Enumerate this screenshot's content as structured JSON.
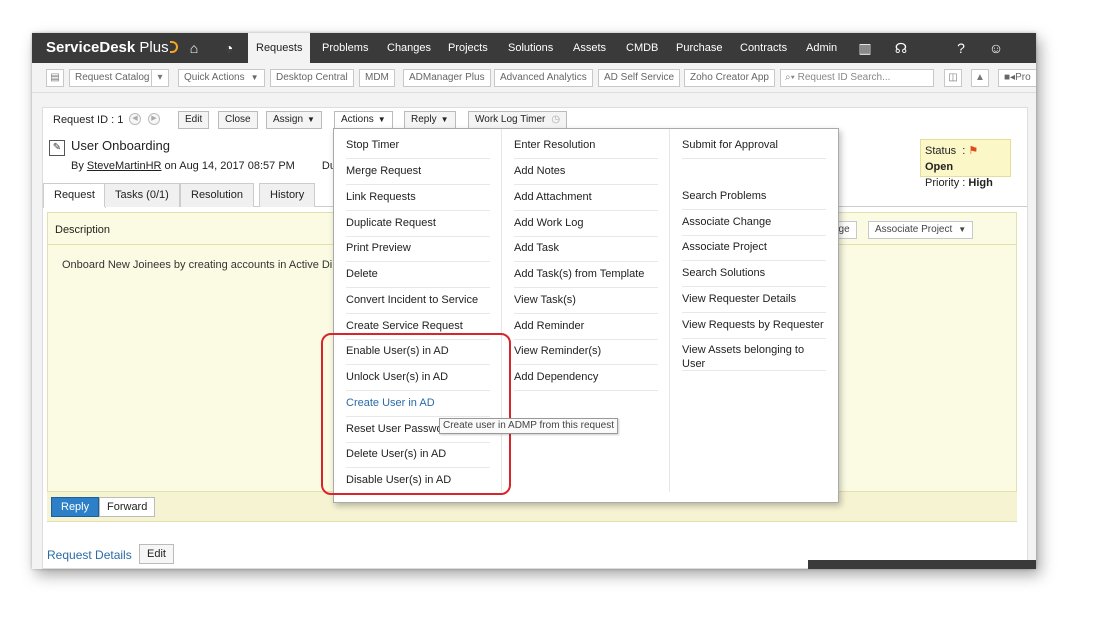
{
  "nav": {
    "brand_main": "ServiceDesk",
    "brand_plus": "Plus",
    "tabs": [
      "Requests",
      "Problems",
      "Changes",
      "Projects",
      "Solutions",
      "Assets",
      "CMDB",
      "Purchase",
      "Contracts",
      "Admin"
    ]
  },
  "subbar": {
    "buttons": [
      "Request Catalog",
      "Quick Actions",
      "Desktop Central",
      "MDM",
      "ADManager Plus",
      "Advanced Analytics",
      "AD Self Service",
      "Zoho Creator App"
    ],
    "search_placeholder": "Request ID Search...",
    "overflow": "Pro"
  },
  "request": {
    "id_label": "Request ID : 1",
    "buttons": {
      "edit": "Edit",
      "close": "Close",
      "assign": "Assign",
      "actions": "Actions",
      "reply": "Reply",
      "worklog": "Work Log Timer"
    },
    "title": "User Onboarding",
    "by_prefix": "By",
    "requester": "SteveMartinHR",
    "on_date": "on  Aug 14, 2017 08:57 PM",
    "du": "Du",
    "status_label": "Status",
    "status_value": "Open",
    "priority_label": "Priority",
    "priority_value": "High",
    "tabs": [
      "Request",
      "Tasks (0/1)",
      "Resolution",
      "History"
    ],
    "description_label": "Description",
    "description_text": "Onboard New Joinees by creating accounts in Active Direct",
    "assoc_change_partial": "nge",
    "assoc_project": "Associate Project",
    "reply_btn": "Reply",
    "forward_btn": "Forward",
    "details_link": "Request Details",
    "details_edit": "Edit"
  },
  "actions_menu": {
    "col1": [
      "Stop Timer",
      "Merge Request",
      "Link Requests",
      "Duplicate Request",
      "Print Preview",
      "Delete",
      "Convert Incident to Service",
      "Create Service Request",
      "Enable User(s) in AD",
      "Unlock User(s) in AD",
      "Create User in AD",
      "Reset User Passwo",
      "Delete User(s) in AD",
      "Disable User(s) in AD"
    ],
    "col2": [
      "Enter Resolution",
      "Add Notes",
      "Add Attachment",
      "Add Work Log",
      "Add Task",
      "Add Task(s) from Template",
      "View Task(s)",
      "Add Reminder",
      "View Reminder(s)",
      "Add Dependency"
    ],
    "col3_top": "Submit for Approval",
    "col3": [
      "Search Problems",
      "Associate Change",
      "Associate Project",
      "Search Solutions",
      "View Requester Details",
      "View Requests by Requester",
      "View Assets belonging to User"
    ]
  },
  "tooltip": "Create user in ADMP from this request"
}
